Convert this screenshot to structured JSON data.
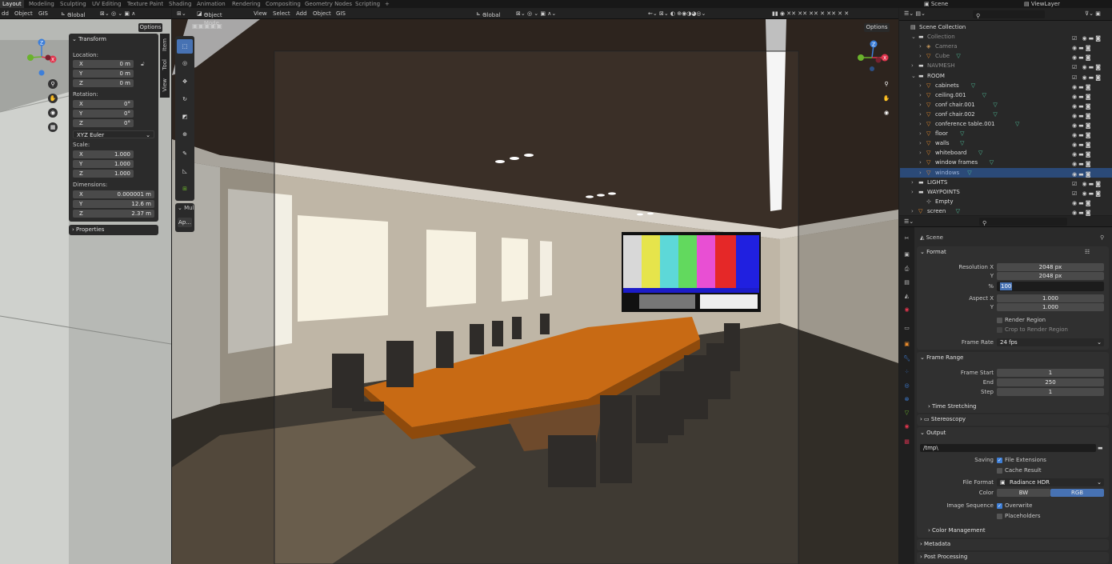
{
  "topbar": {
    "tabs": [
      "Layout",
      "Modeling",
      "Sculpting",
      "UV Editing",
      "Texture Paint",
      "Shading",
      "Animation",
      "Rendering",
      "Compositing",
      "Geometry Nodes",
      "Scripting",
      "+"
    ],
    "scene": "Scene",
    "viewlayer": "ViewLayer"
  },
  "left_header": {
    "add": "dd",
    "object": "Object",
    "gis": "GIS",
    "orientation": "Global",
    "options": "Options"
  },
  "main_header": {
    "mode": "Object Mode",
    "view": "View",
    "select": "Select",
    "add": "Add",
    "object": "Object",
    "gis": "GIS",
    "orientation": "Global",
    "options": "Options"
  },
  "side_tabs": [
    "Item",
    "Tool",
    "View"
  ],
  "transform": {
    "title": "Transform",
    "location_label": "Location:",
    "location": [
      {
        "axis": "X",
        "value": "0 m"
      },
      {
        "axis": "Y",
        "value": "0 m"
      },
      {
        "axis": "Z",
        "value": "0 m"
      }
    ],
    "rotation_label": "Rotation:",
    "rotation": [
      {
        "axis": "X",
        "value": "0°"
      },
      {
        "axis": "Y",
        "value": "0°"
      },
      {
        "axis": "Z",
        "value": "0°"
      }
    ],
    "rotation_mode": "XYZ Euler",
    "scale_label": "Scale:",
    "scale": [
      {
        "axis": "X",
        "value": "1.000"
      },
      {
        "axis": "Y",
        "value": "1.000"
      },
      {
        "axis": "Z",
        "value": "1.000"
      }
    ],
    "dimensions_label": "Dimensions:",
    "dimensions": [
      {
        "axis": "X",
        "value": "0.000001 m"
      },
      {
        "axis": "Y",
        "value": "12.6 m"
      },
      {
        "axis": "Z",
        "value": "2.37 m"
      }
    ],
    "properties": "Properties"
  },
  "tool_panel": {
    "mul": "Mul",
    "ap": "Ap..."
  },
  "outliner": {
    "search_placeholder": "",
    "rows": [
      {
        "name": "Scene Collection",
        "level": 0,
        "kind": "scene"
      },
      {
        "name": "Collection",
        "level": 1,
        "kind": "coll",
        "dim": true
      },
      {
        "name": "Camera",
        "level": 2,
        "kind": "cam",
        "dim": true
      },
      {
        "name": "Cube",
        "level": 2,
        "kind": "mesh",
        "dim": true
      },
      {
        "name": "NAVMESH",
        "level": 1,
        "kind": "coll",
        "dim": true
      },
      {
        "name": "ROOM",
        "level": 1,
        "kind": "coll"
      },
      {
        "name": "cabinets",
        "level": 2,
        "kind": "mesh"
      },
      {
        "name": "ceiling.001",
        "level": 2,
        "kind": "mesh"
      },
      {
        "name": "conf chair.001",
        "level": 2,
        "kind": "mesh"
      },
      {
        "name": "conf chair.002",
        "level": 2,
        "kind": "mesh"
      },
      {
        "name": "conference table.001",
        "level": 2,
        "kind": "mesh"
      },
      {
        "name": "floor",
        "level": 2,
        "kind": "mesh"
      },
      {
        "name": "walls",
        "level": 2,
        "kind": "mesh"
      },
      {
        "name": "whiteboard",
        "level": 2,
        "kind": "mesh"
      },
      {
        "name": "window frames",
        "level": 2,
        "kind": "mesh"
      },
      {
        "name": "windows",
        "level": 2,
        "kind": "mesh",
        "selected": true
      },
      {
        "name": "LIGHTS",
        "level": 1,
        "kind": "coll"
      },
      {
        "name": "WAYPOINTS",
        "level": 1,
        "kind": "coll"
      },
      {
        "name": "Empty",
        "level": 2,
        "kind": "empty"
      },
      {
        "name": "screen",
        "level": 1,
        "kind": "mesh"
      }
    ]
  },
  "properties": {
    "scene": "Scene",
    "format": {
      "title": "Format",
      "res_x_label": "Resolution X",
      "res_x": "2048 px",
      "res_y_label": "Y",
      "res_y": "2048 px",
      "pct_label": "%",
      "pct": "100",
      "aspect_x_label": "Aspect X",
      "aspect_x": "1.000",
      "aspect_y_label": "Y",
      "aspect_y": "1.000",
      "render_region": "Render Region",
      "crop": "Crop to Render Region",
      "frame_rate_label": "Frame Rate",
      "frame_rate": "24 fps"
    },
    "frame_range": {
      "title": "Frame Range",
      "start_label": "Frame Start",
      "start": "1",
      "end_label": "End",
      "end": "250",
      "step_label": "Step",
      "step": "1",
      "time_stretching": "Time Stretching"
    },
    "stereoscopy": "Stereoscopy",
    "output": {
      "title": "Output",
      "path": "/tmp\\",
      "saving_label": "Saving",
      "file_ext": "File Extensions",
      "cache": "Cache Result",
      "file_format_label": "File Format",
      "file_format": "Radiance HDR",
      "color_label": "Color",
      "bw": "BW",
      "rgb": "RGB",
      "image_seq_label": "Image Sequence",
      "overwrite": "Overwrite",
      "placeholders": "Placeholders",
      "color_mgmt": "Color Management"
    },
    "metadata": "Metadata",
    "post": "Post Processing"
  },
  "colors": {
    "accent": "#4772b3",
    "selected_row": "#2b4a78",
    "mesh_icon": "#e88a2b",
    "coll_icon": "#d0d0d0"
  }
}
